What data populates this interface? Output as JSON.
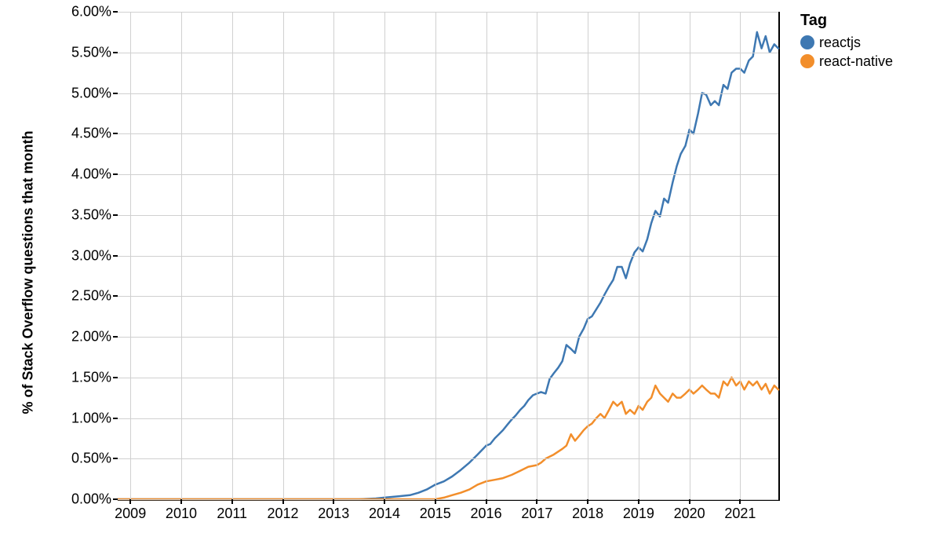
{
  "chart_data": {
    "type": "line",
    "ylabel": "% of Stack Overflow questions that month",
    "xlabel": "",
    "legend_title": "Tag",
    "xlim": [
      2008.75,
      2021.75
    ],
    "ylim": [
      0,
      6
    ],
    "y_ticks": [
      0.0,
      0.5,
      1.0,
      1.5,
      2.0,
      2.5,
      3.0,
      3.5,
      4.0,
      4.5,
      5.0,
      5.5,
      6.0
    ],
    "y_tick_labels": [
      "0.00%",
      "0.50%",
      "1.00%",
      "1.50%",
      "2.00%",
      "2.50%",
      "3.00%",
      "3.50%",
      "4.00%",
      "4.50%",
      "5.00%",
      "5.50%",
      "6.00%"
    ],
    "x_ticks": [
      2009,
      2010,
      2011,
      2012,
      2013,
      2014,
      2015,
      2016,
      2017,
      2018,
      2019,
      2020,
      2021
    ],
    "x_tick_labels": [
      "2009",
      "2010",
      "2011",
      "2012",
      "2013",
      "2014",
      "2015",
      "2016",
      "2017",
      "2018",
      "2019",
      "2020",
      "2021"
    ],
    "series": [
      {
        "name": "reactjs",
        "color": "#3e78b2",
        "data": [
          {
            "x": 2008.75,
            "y": 0.0
          },
          {
            "x": 2009.0,
            "y": 0.0
          },
          {
            "x": 2009.5,
            "y": 0.0
          },
          {
            "x": 2010.0,
            "y": 0.0
          },
          {
            "x": 2010.5,
            "y": 0.0
          },
          {
            "x": 2011.0,
            "y": 0.0
          },
          {
            "x": 2011.5,
            "y": 0.0
          },
          {
            "x": 2012.0,
            "y": 0.0
          },
          {
            "x": 2012.5,
            "y": 0.0
          },
          {
            "x": 2013.0,
            "y": 0.0
          },
          {
            "x": 2013.5,
            "y": 0.0
          },
          {
            "x": 2013.83,
            "y": 0.01
          },
          {
            "x": 2014.0,
            "y": 0.02
          },
          {
            "x": 2014.17,
            "y": 0.03
          },
          {
            "x": 2014.33,
            "y": 0.04
          },
          {
            "x": 2014.5,
            "y": 0.05
          },
          {
            "x": 2014.67,
            "y": 0.08
          },
          {
            "x": 2014.83,
            "y": 0.12
          },
          {
            "x": 2015.0,
            "y": 0.18
          },
          {
            "x": 2015.17,
            "y": 0.22
          },
          {
            "x": 2015.33,
            "y": 0.28
          },
          {
            "x": 2015.5,
            "y": 0.36
          },
          {
            "x": 2015.67,
            "y": 0.45
          },
          {
            "x": 2015.83,
            "y": 0.55
          },
          {
            "x": 2016.0,
            "y": 0.66
          },
          {
            "x": 2016.08,
            "y": 0.68
          },
          {
            "x": 2016.17,
            "y": 0.75
          },
          {
            "x": 2016.25,
            "y": 0.8
          },
          {
            "x": 2016.33,
            "y": 0.85
          },
          {
            "x": 2016.42,
            "y": 0.92
          },
          {
            "x": 2016.5,
            "y": 0.98
          },
          {
            "x": 2016.58,
            "y": 1.03
          },
          {
            "x": 2016.67,
            "y": 1.1
          },
          {
            "x": 2016.75,
            "y": 1.15
          },
          {
            "x": 2016.83,
            "y": 1.22
          },
          {
            "x": 2016.92,
            "y": 1.28
          },
          {
            "x": 2017.0,
            "y": 1.3
          },
          {
            "x": 2017.08,
            "y": 1.32
          },
          {
            "x": 2017.17,
            "y": 1.3
          },
          {
            "x": 2017.25,
            "y": 1.48
          },
          {
            "x": 2017.33,
            "y": 1.55
          },
          {
            "x": 2017.42,
            "y": 1.62
          },
          {
            "x": 2017.5,
            "y": 1.7
          },
          {
            "x": 2017.58,
            "y": 1.9
          },
          {
            "x": 2017.67,
            "y": 1.85
          },
          {
            "x": 2017.75,
            "y": 1.8
          },
          {
            "x": 2017.83,
            "y": 2.0
          },
          {
            "x": 2017.92,
            "y": 2.1
          },
          {
            "x": 2018.0,
            "y": 2.22
          },
          {
            "x": 2018.08,
            "y": 2.25
          },
          {
            "x": 2018.17,
            "y": 2.34
          },
          {
            "x": 2018.25,
            "y": 2.42
          },
          {
            "x": 2018.33,
            "y": 2.52
          },
          {
            "x": 2018.42,
            "y": 2.62
          },
          {
            "x": 2018.5,
            "y": 2.7
          },
          {
            "x": 2018.58,
            "y": 2.86
          },
          {
            "x": 2018.67,
            "y": 2.86
          },
          {
            "x": 2018.75,
            "y": 2.72
          },
          {
            "x": 2018.83,
            "y": 2.9
          },
          {
            "x": 2018.92,
            "y": 3.04
          },
          {
            "x": 2019.0,
            "y": 3.1
          },
          {
            "x": 2019.08,
            "y": 3.05
          },
          {
            "x": 2019.17,
            "y": 3.2
          },
          {
            "x": 2019.25,
            "y": 3.4
          },
          {
            "x": 2019.33,
            "y": 3.55
          },
          {
            "x": 2019.42,
            "y": 3.48
          },
          {
            "x": 2019.5,
            "y": 3.7
          },
          {
            "x": 2019.58,
            "y": 3.65
          },
          {
            "x": 2019.67,
            "y": 3.9
          },
          {
            "x": 2019.75,
            "y": 4.1
          },
          {
            "x": 2019.83,
            "y": 4.25
          },
          {
            "x": 2019.92,
            "y": 4.35
          },
          {
            "x": 2020.0,
            "y": 4.55
          },
          {
            "x": 2020.08,
            "y": 4.5
          },
          {
            "x": 2020.17,
            "y": 4.75
          },
          {
            "x": 2020.25,
            "y": 5.0
          },
          {
            "x": 2020.33,
            "y": 4.98
          },
          {
            "x": 2020.42,
            "y": 4.85
          },
          {
            "x": 2020.5,
            "y": 4.9
          },
          {
            "x": 2020.58,
            "y": 4.85
          },
          {
            "x": 2020.67,
            "y": 5.1
          },
          {
            "x": 2020.75,
            "y": 5.05
          },
          {
            "x": 2020.83,
            "y": 5.25
          },
          {
            "x": 2020.92,
            "y": 5.3
          },
          {
            "x": 2021.0,
            "y": 5.3
          },
          {
            "x": 2021.08,
            "y": 5.25
          },
          {
            "x": 2021.17,
            "y": 5.4
          },
          {
            "x": 2021.25,
            "y": 5.45
          },
          {
            "x": 2021.33,
            "y": 5.75
          },
          {
            "x": 2021.42,
            "y": 5.55
          },
          {
            "x": 2021.5,
            "y": 5.7
          },
          {
            "x": 2021.58,
            "y": 5.5
          },
          {
            "x": 2021.67,
            "y": 5.6
          },
          {
            "x": 2021.75,
            "y": 5.55
          }
        ]
      },
      {
        "name": "react-native",
        "color": "#f28e2b",
        "data": [
          {
            "x": 2008.75,
            "y": 0.0
          },
          {
            "x": 2009.0,
            "y": 0.0
          },
          {
            "x": 2010.0,
            "y": 0.0
          },
          {
            "x": 2011.0,
            "y": 0.0
          },
          {
            "x": 2012.0,
            "y": 0.0
          },
          {
            "x": 2013.0,
            "y": 0.0
          },
          {
            "x": 2014.0,
            "y": 0.0
          },
          {
            "x": 2014.5,
            "y": 0.0
          },
          {
            "x": 2015.0,
            "y": 0.0
          },
          {
            "x": 2015.17,
            "y": 0.02
          },
          {
            "x": 2015.33,
            "y": 0.05
          },
          {
            "x": 2015.5,
            "y": 0.08
          },
          {
            "x": 2015.67,
            "y": 0.12
          },
          {
            "x": 2015.83,
            "y": 0.18
          },
          {
            "x": 2016.0,
            "y": 0.22
          },
          {
            "x": 2016.17,
            "y": 0.24
          },
          {
            "x": 2016.33,
            "y": 0.26
          },
          {
            "x": 2016.5,
            "y": 0.3
          },
          {
            "x": 2016.67,
            "y": 0.35
          },
          {
            "x": 2016.83,
            "y": 0.4
          },
          {
            "x": 2017.0,
            "y": 0.42
          },
          {
            "x": 2017.08,
            "y": 0.45
          },
          {
            "x": 2017.17,
            "y": 0.5
          },
          {
            "x": 2017.33,
            "y": 0.55
          },
          {
            "x": 2017.5,
            "y": 0.62
          },
          {
            "x": 2017.58,
            "y": 0.66
          },
          {
            "x": 2017.67,
            "y": 0.8
          },
          {
            "x": 2017.75,
            "y": 0.72
          },
          {
            "x": 2017.83,
            "y": 0.78
          },
          {
            "x": 2017.92,
            "y": 0.85
          },
          {
            "x": 2018.0,
            "y": 0.9
          },
          {
            "x": 2018.08,
            "y": 0.93
          },
          {
            "x": 2018.17,
            "y": 1.0
          },
          {
            "x": 2018.25,
            "y": 1.05
          },
          {
            "x": 2018.33,
            "y": 1.0
          },
          {
            "x": 2018.42,
            "y": 1.1
          },
          {
            "x": 2018.5,
            "y": 1.2
          },
          {
            "x": 2018.58,
            "y": 1.15
          },
          {
            "x": 2018.67,
            "y": 1.2
          },
          {
            "x": 2018.75,
            "y": 1.05
          },
          {
            "x": 2018.83,
            "y": 1.1
          },
          {
            "x": 2018.92,
            "y": 1.05
          },
          {
            "x": 2019.0,
            "y": 1.15
          },
          {
            "x": 2019.08,
            "y": 1.1
          },
          {
            "x": 2019.17,
            "y": 1.2
          },
          {
            "x": 2019.25,
            "y": 1.25
          },
          {
            "x": 2019.33,
            "y": 1.4
          },
          {
            "x": 2019.42,
            "y": 1.3
          },
          {
            "x": 2019.5,
            "y": 1.25
          },
          {
            "x": 2019.58,
            "y": 1.2
          },
          {
            "x": 2019.67,
            "y": 1.3
          },
          {
            "x": 2019.75,
            "y": 1.25
          },
          {
            "x": 2019.83,
            "y": 1.25
          },
          {
            "x": 2019.92,
            "y": 1.3
          },
          {
            "x": 2020.0,
            "y": 1.35
          },
          {
            "x": 2020.08,
            "y": 1.3
          },
          {
            "x": 2020.17,
            "y": 1.35
          },
          {
            "x": 2020.25,
            "y": 1.4
          },
          {
            "x": 2020.33,
            "y": 1.35
          },
          {
            "x": 2020.42,
            "y": 1.3
          },
          {
            "x": 2020.5,
            "y": 1.3
          },
          {
            "x": 2020.58,
            "y": 1.25
          },
          {
            "x": 2020.67,
            "y": 1.45
          },
          {
            "x": 2020.75,
            "y": 1.4
          },
          {
            "x": 2020.83,
            "y": 1.5
          },
          {
            "x": 2020.92,
            "y": 1.4
          },
          {
            "x": 2021.0,
            "y": 1.45
          },
          {
            "x": 2021.08,
            "y": 1.35
          },
          {
            "x": 2021.17,
            "y": 1.45
          },
          {
            "x": 2021.25,
            "y": 1.4
          },
          {
            "x": 2021.33,
            "y": 1.45
          },
          {
            "x": 2021.42,
            "y": 1.35
          },
          {
            "x": 2021.5,
            "y": 1.42
          },
          {
            "x": 2021.58,
            "y": 1.3
          },
          {
            "x": 2021.67,
            "y": 1.4
          },
          {
            "x": 2021.75,
            "y": 1.35
          }
        ]
      }
    ]
  }
}
